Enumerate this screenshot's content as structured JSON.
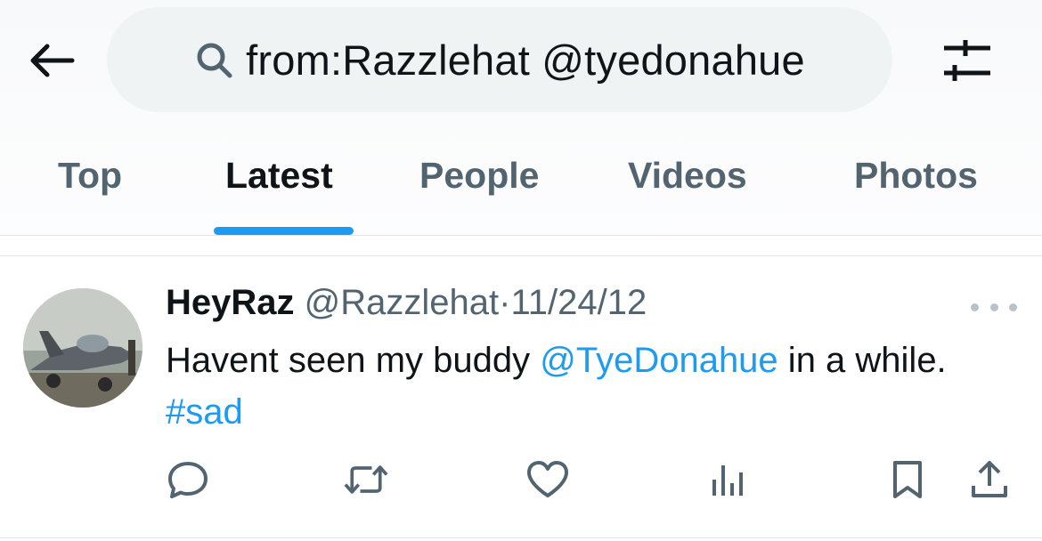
{
  "search": {
    "query": "from:Razzlehat @tyedonahue"
  },
  "tabs": [
    {
      "label": "Top",
      "active": false
    },
    {
      "label": "Latest",
      "active": true
    },
    {
      "label": "People",
      "active": false
    },
    {
      "label": "Videos",
      "active": false
    },
    {
      "label": "Photos",
      "active": false
    }
  ],
  "tweet": {
    "display_name": "HeyRaz",
    "handle": "@Razzlehat",
    "separator": "·",
    "date": "11/24/12",
    "text_before": "Havent seen my buddy ",
    "mention": "@TyeDonahue",
    "text_middle": " in a while. ",
    "hashtag": "#sad"
  },
  "icons": {
    "back": "back-arrow-icon",
    "search": "search-icon",
    "filter": "filter-sliders-icon",
    "more": "more-dots-icon",
    "reply": "reply-icon",
    "retweet": "retweet-icon",
    "like": "like-icon",
    "views": "views-icon",
    "bookmark": "bookmark-icon",
    "share": "share-icon"
  },
  "colors": {
    "accent": "#1d9bf0",
    "primary_text": "#0f1419",
    "secondary_text": "#536471",
    "search_background": "#eff3f4"
  }
}
